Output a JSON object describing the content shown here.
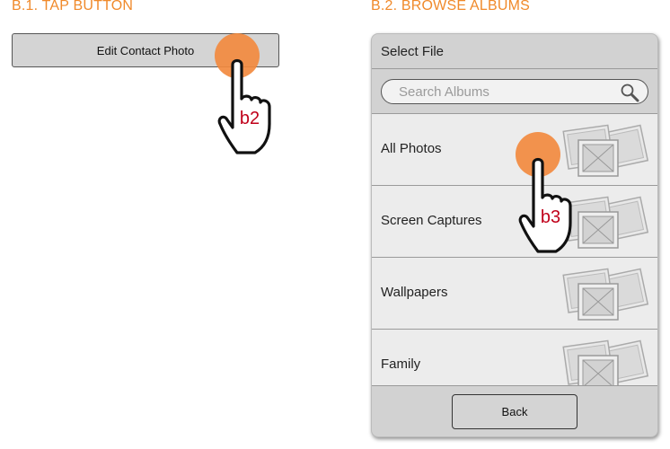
{
  "steps": {
    "b1_title": "B.1. TAP BUTTON",
    "b2_title": "B.2. BROWSE ALBUMS"
  },
  "step1": {
    "button_label": "Edit Contact Photo"
  },
  "dialog": {
    "title": "Select File",
    "search_placeholder": "Search Albums",
    "albums": [
      {
        "name": "All Photos"
      },
      {
        "name": "Screen Captures"
      },
      {
        "name": "Wallpapers"
      },
      {
        "name": "Family"
      }
    ],
    "back_label": "Back"
  },
  "annotations": {
    "b2": "b2",
    "b3": "b3"
  },
  "colors": {
    "accent": "#f08a2b",
    "tap": "#f28a3f",
    "label": "#c0001a"
  }
}
